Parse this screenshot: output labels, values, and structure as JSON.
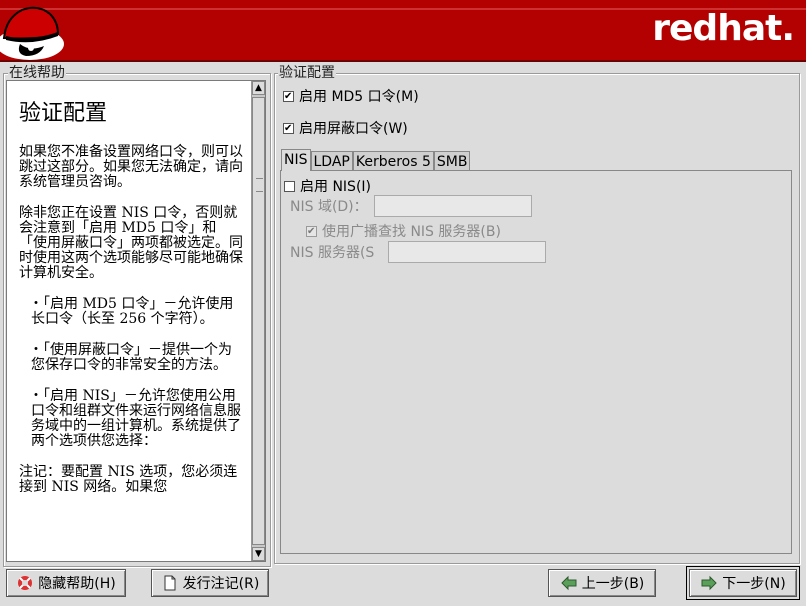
{
  "banner": {
    "brand": "redhat."
  },
  "help": {
    "group_label": "在线帮助",
    "title": "验证配置",
    "paragraphs": [
      "如果您不准备设置网络口令，则可以跳过这部分。如果您无法确定，请向系统管理员咨询。",
      "除非您正在设置 NIS 口令，否则就会注意到「启用 MD5 口令」和「使用屏蔽口令」两项都被选定。同时使用这两个选项能够尽可能地确保计算机安全。",
      "・「启用 MD5 口令」－允许使用长口令（长至 256 个字符）。",
      "・「使用屏蔽口令」－提供一个为您保存口令的非常安全的方法。",
      "・「启用 NIS」－允许您使用公用口令和组群文件来运行网络信息服务域中的一组计算机。系统提供了两个选项供您选择：",
      "注记：要配置 NIS 选项，您必须连接到 NIS 网络。如果您"
    ]
  },
  "auth": {
    "group_label": "验证配置",
    "md5": {
      "label": "启用 MD5 口令(M)",
      "checked": true
    },
    "shadow": {
      "label": "启用屏蔽口令(W)",
      "checked": true
    },
    "tabs": [
      "NIS",
      "LDAP",
      "Kerberos 5",
      "SMB"
    ],
    "active_tab": "NIS",
    "nis": {
      "enable_label": "启用 NIS(I)",
      "enable_checked": false,
      "domain_label": "NIS 域(D)：",
      "domain_value": "",
      "broadcast_label": "使用广播查找 NIS 服务器(B)",
      "broadcast_checked": true,
      "server_label": "NIS 服务器(S",
      "server_value": ""
    }
  },
  "buttons": {
    "hide_help": "隐藏帮助(H)",
    "release_notes": "发行注记(R)",
    "back": "上一步(B)",
    "next": "下一步(N)"
  },
  "colors": {
    "banner": "#b30000",
    "background": "#dcdcdc"
  },
  "icons": {
    "logo": "shadowman-hat-logo",
    "hide_help": "lifebuoy-icon",
    "release_notes": "document-icon",
    "back": "left-arrow-icon",
    "next": "right-arrow-icon"
  }
}
